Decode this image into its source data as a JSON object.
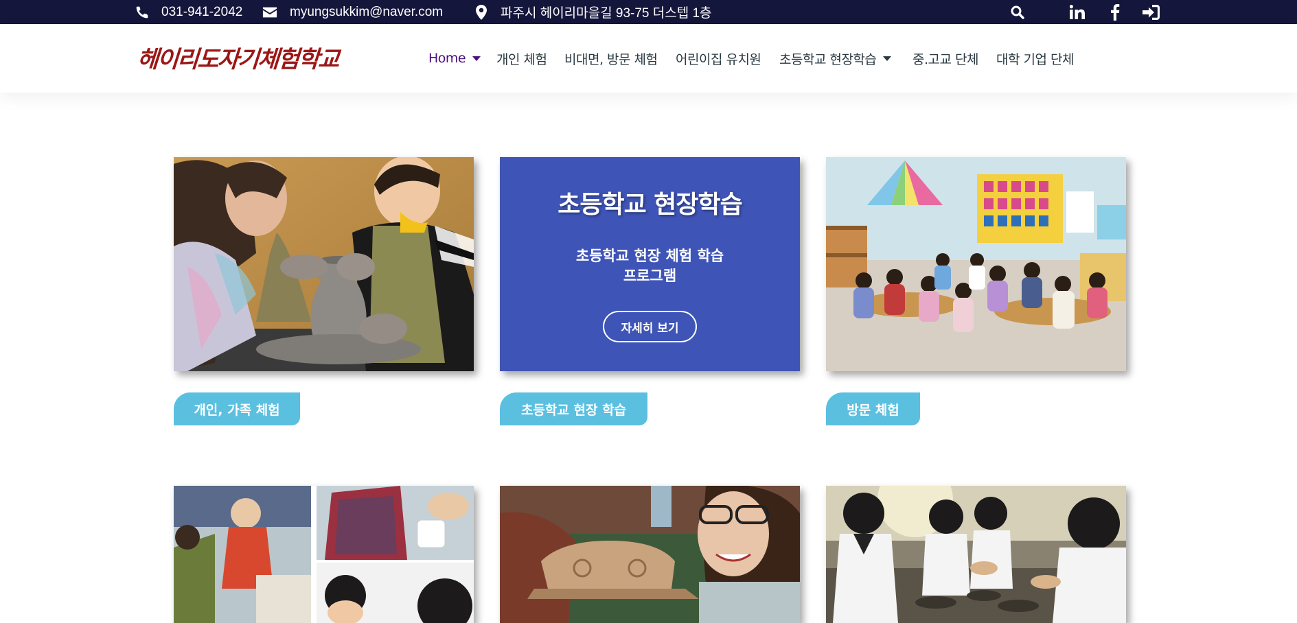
{
  "topbar": {
    "phone": "031-941-2042",
    "email": "myungsukkim@naver.com",
    "address": "파주시 헤이리마을길 93-75 더스텝 1층",
    "icons": [
      "search-icon",
      "linkedin-icon",
      "facebook-icon",
      "login-icon"
    ]
  },
  "header": {
    "logo": "헤이리도자기체험학교",
    "nav": [
      {
        "label": "Home",
        "dropdown": true
      },
      {
        "label": "개인 체험",
        "dropdown": false
      },
      {
        "label": "비대면, 방문 체험",
        "dropdown": false
      },
      {
        "label": "어린이집 유치원",
        "dropdown": false
      },
      {
        "label": "초등학교 현장학습",
        "dropdown": true
      },
      {
        "label": "중.고교 단체",
        "dropdown": false
      },
      {
        "label": "대학 기업 단체",
        "dropdown": false
      }
    ]
  },
  "promo": {
    "title": "초등학교 현장학습",
    "subtitle_line1": "초등학교 현장 체험 학습",
    "subtitle_line2": "프로그램",
    "button": "자세히 보기"
  },
  "tags": {
    "tag1": "개인, 가족 체험",
    "tag2": "초등학교 현장 학습",
    "tag3": "방문 체험"
  },
  "colors": {
    "topbar_bg": "#15163b",
    "nav_active": "#4a0e80",
    "logo": "#9c1616",
    "promo_bg": "#3e54b6",
    "tag_bg": "#5bbfe0"
  }
}
